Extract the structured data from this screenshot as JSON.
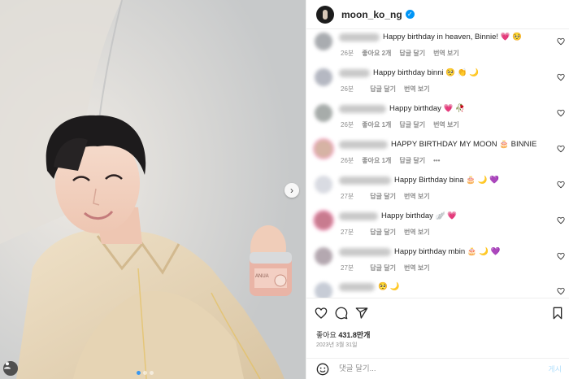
{
  "post": {
    "username": "moon_ko_ng",
    "likes_label": "좋아요",
    "likes_count": "431.8만개",
    "date": "2023년 3월 31일",
    "comment_placeholder": "댓글 달기...",
    "post_button": "게시"
  },
  "photo": {
    "product_text": "ANUA"
  },
  "comments": [
    {
      "text": "Happy birthday in heaven, Binnie! 💗 🥺",
      "time": "26분",
      "likes": "좋아요 2개",
      "reply": "답글 달기",
      "translate": "번역 보기",
      "avatar": "#a9acb0",
      "ring": false
    },
    {
      "text": "Happy birthday binni 🥺 👏 🌙",
      "time": "26분",
      "likes": "",
      "reply": "답글 달기",
      "translate": "번역 보기",
      "avatar": "#b5b8c2",
      "ring": false
    },
    {
      "text": "Happy birthday 💗 🥀",
      "time": "26분",
      "likes": "좋아요 1개",
      "reply": "답글 달기",
      "translate": "번역 보기",
      "avatar": "#a7acaa",
      "ring": false
    },
    {
      "text": "HAPPY BIRTHDAY MY MOON 🎂 BINNIE",
      "time": "26분",
      "likes": "좋아요 1개",
      "reply": "답글 달기",
      "translate": "•••",
      "avatar": "#d6b3a4",
      "ring": true
    },
    {
      "text": "Happy Birthday bina 🎂 🌙 💜",
      "time": "27분",
      "likes": "",
      "reply": "답글 달기",
      "translate": "번역 보기",
      "avatar": "#d9dbe2",
      "ring": false
    },
    {
      "text": "Happy birthday 🪽 💗",
      "time": "27분",
      "likes": "",
      "reply": "답글 달기",
      "translate": "번역 보기",
      "avatar": "#c87b8f",
      "ring": true
    },
    {
      "text": "Happy birthday mbin 🎂 🌙 💜",
      "time": "27분",
      "likes": "",
      "reply": "답글 달기",
      "translate": "번역 보기",
      "avatar": "#b4a8b0",
      "ring": false
    },
    {
      "text": "🥺 🌙",
      "time": "",
      "likes": "",
      "reply": "",
      "translate": "",
      "avatar": "#c7ccd6",
      "ring": false
    }
  ]
}
